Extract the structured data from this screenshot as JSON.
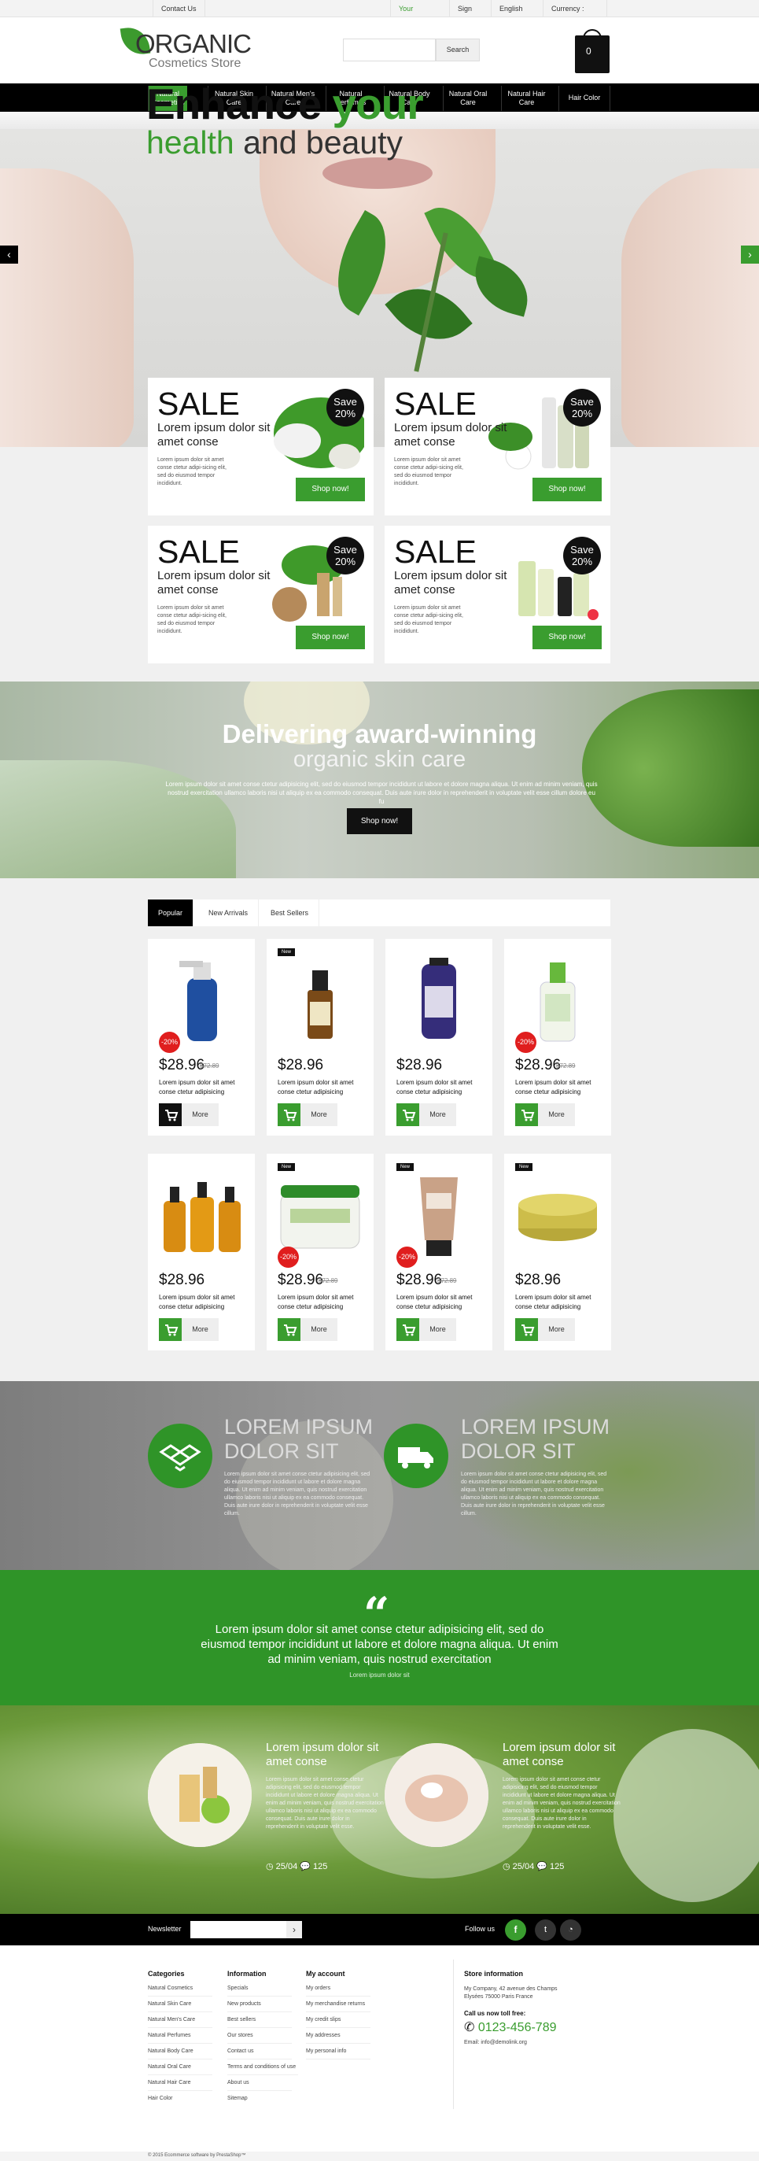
{
  "topbar": {
    "contact": "Contact Us",
    "account": "Your Account",
    "signin": "Sign in",
    "language": "English",
    "currency": "Currency : USD"
  },
  "header": {
    "logo_main": "ORGANIC",
    "logo_sub": "Cosmetics Store",
    "search_placeholder": "",
    "search_button": "Search",
    "cart_count": "0"
  },
  "nav": [
    {
      "label": "Natural Cosmetics"
    },
    {
      "label": "Natural Skin Care"
    },
    {
      "label": "Natural Men's Care"
    },
    {
      "label": "Natural Perfumes"
    },
    {
      "label": "Natural Body Care"
    },
    {
      "label": "Natural Oral Care"
    },
    {
      "label": "Natural Hair Care"
    },
    {
      "label": "Hair Color"
    }
  ],
  "hero": {
    "title_a": "Enhance ",
    "title_b": "your",
    "sub_a": "health",
    "sub_b": " and beauty"
  },
  "promos": [
    {
      "sale": "SALE",
      "title": "Lorem ipsum dolor sit amet conse",
      "text": "Lorem ipsum dolor sit amet conse ctetur adipi-sicing elit, sed do eiusmod tempor incididunt.",
      "save": "Save 20%",
      "button": "Shop now!"
    },
    {
      "sale": "SALE",
      "title": "Lorem ipsum dolor sit amet conse",
      "text": "Lorem ipsum dolor sit amet conse ctetur adipi-sicing elit, sed do eiusmod tempor incididunt.",
      "save": "Save 20%",
      "button": "Shop now!"
    },
    {
      "sale": "SALE",
      "title": "Lorem ipsum dolor sit amet conse",
      "text": "Lorem ipsum dolor sit amet conse ctetur adipi-sicing elit, sed do eiusmod tempor incididunt.",
      "save": "Save 20%",
      "button": "Shop now!"
    },
    {
      "sale": "SALE",
      "title": "Lorem ipsum dolor sit amet conse",
      "text": "Lorem ipsum dolor sit amet conse ctetur adipi-sicing elit, sed do eiusmod tempor incididunt.",
      "save": "Save 20%",
      "button": "Shop now!"
    }
  ],
  "aloe": {
    "title": "Delivering award-winning",
    "sub": "organic skin care",
    "text": "Lorem ipsum dolor sit amet conse ctetur adipisicing elit, sed do eiusmod tempor incididunt ut labore et dolore magna aliqua. Ut enim ad minim veniam, quis nostrud exercitation ullamco laboris nisi ut aliquip ex ea commodo consequat. Duis aute irure dolor in reprehenderit in voluptate velit esse cillum dolore eu fu",
    "button": "Shop now!"
  },
  "tabs": [
    "Popular",
    "New Arrivals",
    "Best Sellers"
  ],
  "products": [
    {
      "price": "$28.96",
      "old": "$72.89",
      "discount": "-20%",
      "badge": "",
      "name": "Lorem ipsum dolor sit amet conse ctetur adipisicing",
      "more": "More"
    },
    {
      "price": "$28.96",
      "old": "",
      "discount": "",
      "badge": "New",
      "name": "Lorem ipsum dolor sit amet conse ctetur adipisicing",
      "more": "More"
    },
    {
      "price": "$28.96",
      "old": "",
      "discount": "",
      "badge": "",
      "name": "Lorem ipsum dolor sit amet conse ctetur adipisicing",
      "more": "More"
    },
    {
      "price": "$28.96",
      "old": "$72.89",
      "discount": "-20%",
      "badge": "",
      "name": "Lorem ipsum dolor sit amet conse ctetur adipisicing",
      "more": "More"
    },
    {
      "price": "$28.96",
      "old": "",
      "discount": "",
      "badge": "",
      "name": "Lorem ipsum dolor sit amet conse ctetur adipisicing",
      "more": "More"
    },
    {
      "price": "$28.96",
      "old": "$72.89",
      "discount": "-20%",
      "badge": "New",
      "name": "Lorem ipsum dolor sit amet conse ctetur adipisicing",
      "more": "More"
    },
    {
      "price": "$28.96",
      "old": "$72.89",
      "discount": "-20%",
      "badge": "New",
      "name": "Lorem ipsum dolor sit amet conse ctetur adipisicing",
      "more": "More"
    },
    {
      "price": "$28.96",
      "old": "",
      "discount": "",
      "badge": "New",
      "name": "Lorem ipsum dolor sit amet conse ctetur adipisicing",
      "more": "More"
    }
  ],
  "features": [
    {
      "title": "LOREM IPSUM DOLOR SIT",
      "text": "Lorem ipsum dolor sit amet conse ctetur adipisicing elit, sed do eiusmod tempor incididunt ut labore et dolore magna aliqua. Ut enim ad minim veniam, quis nostrud exercitation ullamco laboris nisi ut aliquip ex ea commodo consequat. Duis aute irure dolor in reprehenderit in voluptate velit esse cillum.",
      "icon": "dropbox-icon"
    },
    {
      "title": "LOREM IPSUM DOLOR SIT",
      "text": "Lorem ipsum dolor sit amet conse ctetur adipisicing elit, sed do eiusmod tempor incididunt ut labore et dolore magna aliqua. Ut enim ad minim veniam, quis nostrud exercitation ullamco laboris nisi ut aliquip ex ea commodo consequat. Duis aute irure dolor in reprehenderit in voluptate velit esse cillum.",
      "icon": "truck-icon"
    }
  ],
  "quote": {
    "text": "Lorem ipsum dolor sit amet conse ctetur adipisicing elit, sed do eiusmod tempor incididunt ut labore et dolore magna aliqua. Ut enim ad minim veniam, quis nostrud exercitation",
    "author": "Lorem ipsum dolor sit"
  },
  "blog": [
    {
      "title": "Lorem ipsum dolor sit amet conse",
      "text": "Lorem ipsum dolor sit amet conse ctetur adipisicing elit, sed do eiusmod tempor incididunt ut labore et dolore magna aliqua. Ut enim ad minim veniam, quis nostrud exercitation ullamco laboris nisi ut aliquip ex ea commodo consequat. Duis aute irure dolor in reprehenderit in voluptate velit esse.",
      "date": "25/04",
      "comments": "125"
    },
    {
      "title": "Lorem ipsum dolor sit amet conse",
      "text": "Lorem ipsum dolor sit amet conse ctetur adipisicing elit, sed do eiusmod tempor incididunt ut labore et dolore magna aliqua. Ut enim ad minim veniam, quis nostrud exercitation ullamco laboris nisi ut aliquip ex ea commodo consequat. Duis aute irure dolor in reprehenderit in voluptate velit esse.",
      "date": "25/04",
      "comments": "125"
    }
  ],
  "newsletter": {
    "label": "Newsletter",
    "follow": "Follow us"
  },
  "footer": {
    "categories_title": "Categories",
    "categories": [
      "Natural Cosmetics",
      "Natural Skin Care",
      "Natural Men's Care",
      "Natural Perfumes",
      "Natural Body Care",
      "Natural Oral Care",
      "Natural Hair Care",
      "Hair Color"
    ],
    "info_title": "Information",
    "info": [
      "Specials",
      "New products",
      "Best sellers",
      "Our stores",
      "Contact us",
      "Terms and conditions of use",
      "About us",
      "Sitemap"
    ],
    "account_title": "My account",
    "account": [
      "My orders",
      "My merchandise returns",
      "My credit slips",
      "My addresses",
      "My personal info"
    ],
    "store_title": "Store information",
    "store_address": "My Company, 42 avenue des Champs Elysées 75000 Paris France",
    "call_label": "Call us now toll free:",
    "phone": "0123-456-789",
    "email_label": "Email:",
    "email": "info@demolink.org",
    "copyright": "© 2015 Ecommerce software by PrestaShop™"
  },
  "colors": {
    "accent": "#3a9d2f",
    "dark": "#000000",
    "sale": "#e01e1e"
  }
}
